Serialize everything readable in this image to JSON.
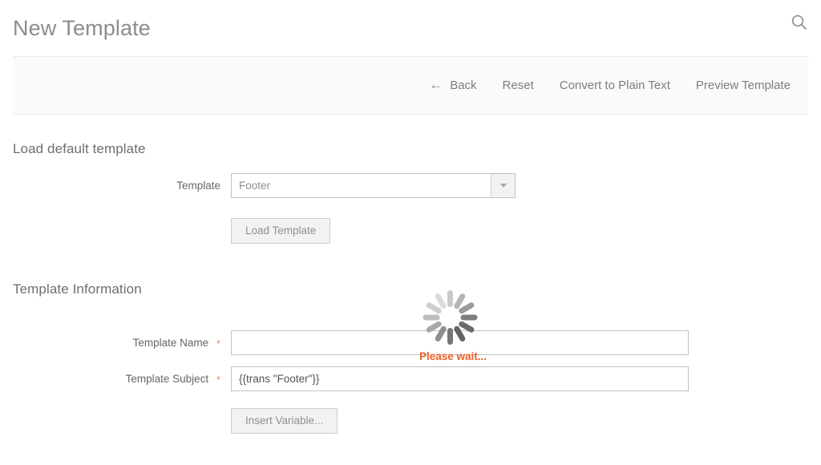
{
  "header": {
    "title": "New Template",
    "search_icon": "search-icon"
  },
  "toolbar": {
    "back_arrow": "←",
    "back_label": "Back",
    "reset_label": "Reset",
    "convert_label": "Convert to Plain Text",
    "preview_label": "Preview Template"
  },
  "load_default_section": {
    "title": "Load default template",
    "template_field": {
      "label": "Template",
      "value": "Footer",
      "dropdown_icon": "chevron-down-icon",
      "options": [
        "Footer"
      ]
    },
    "load_button_label": "Load Template"
  },
  "template_information_section": {
    "title": "Template Information",
    "required_marker": "*",
    "template_name": {
      "label": "Template Name",
      "value": "",
      "placeholder": ""
    },
    "template_subject": {
      "label": "Template Subject",
      "value": "{{trans \"Footer\"}}",
      "placeholder": ""
    },
    "insert_variable_label": "Insert Variable..."
  },
  "loader": {
    "text": "Please wait...",
    "spoke_count": 12,
    "colors": {
      "accent": "#ec5f28",
      "spoke_light": "#dedede",
      "spoke_dark": "#626262"
    }
  },
  "colors": {
    "page_background": "#ffffff",
    "toolbar_background": "#fafafa",
    "title_text": "#8c8c8c",
    "label_text": "#666666",
    "required_star": "#e98a6a",
    "input_border": "#c2c2c2",
    "button_background": "#f2f2f2"
  }
}
